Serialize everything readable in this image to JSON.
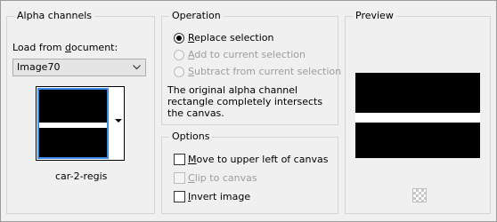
{
  "alpha_channels": {
    "title": "Alpha channels",
    "load_label_prefix": "Load from ",
    "load_label_key": "d",
    "load_label_suffix": "ocument:",
    "selected_document": "Image70",
    "channel_name": "car-2-regis"
  },
  "operation": {
    "title": "Operation",
    "options": [
      {
        "key": "R",
        "rest": "eplace selection",
        "selected": true,
        "enabled": true
      },
      {
        "key": "A",
        "rest": "dd to current selection",
        "selected": false,
        "enabled": false
      },
      {
        "key": "S",
        "rest": "ubtract from current selection",
        "selected": false,
        "enabled": false
      }
    ],
    "description": "The original alpha channel rectangle completely intersects the canvas."
  },
  "options": {
    "title": "Options",
    "items": [
      {
        "key": "M",
        "rest": "ove to upper left of canvas",
        "checked": false,
        "enabled": true
      },
      {
        "key": "C",
        "rest": "lip to canvas",
        "checked": false,
        "enabled": false
      },
      {
        "key": "I",
        "rest": "nvert image",
        "checked": false,
        "enabled": true
      }
    ]
  },
  "preview": {
    "title": "Preview"
  },
  "icons": {
    "dropdown": "chevron-down-icon",
    "thumbnail_dropdown": "triangle-down-icon",
    "background_toggle": "checkerboard-icon"
  }
}
